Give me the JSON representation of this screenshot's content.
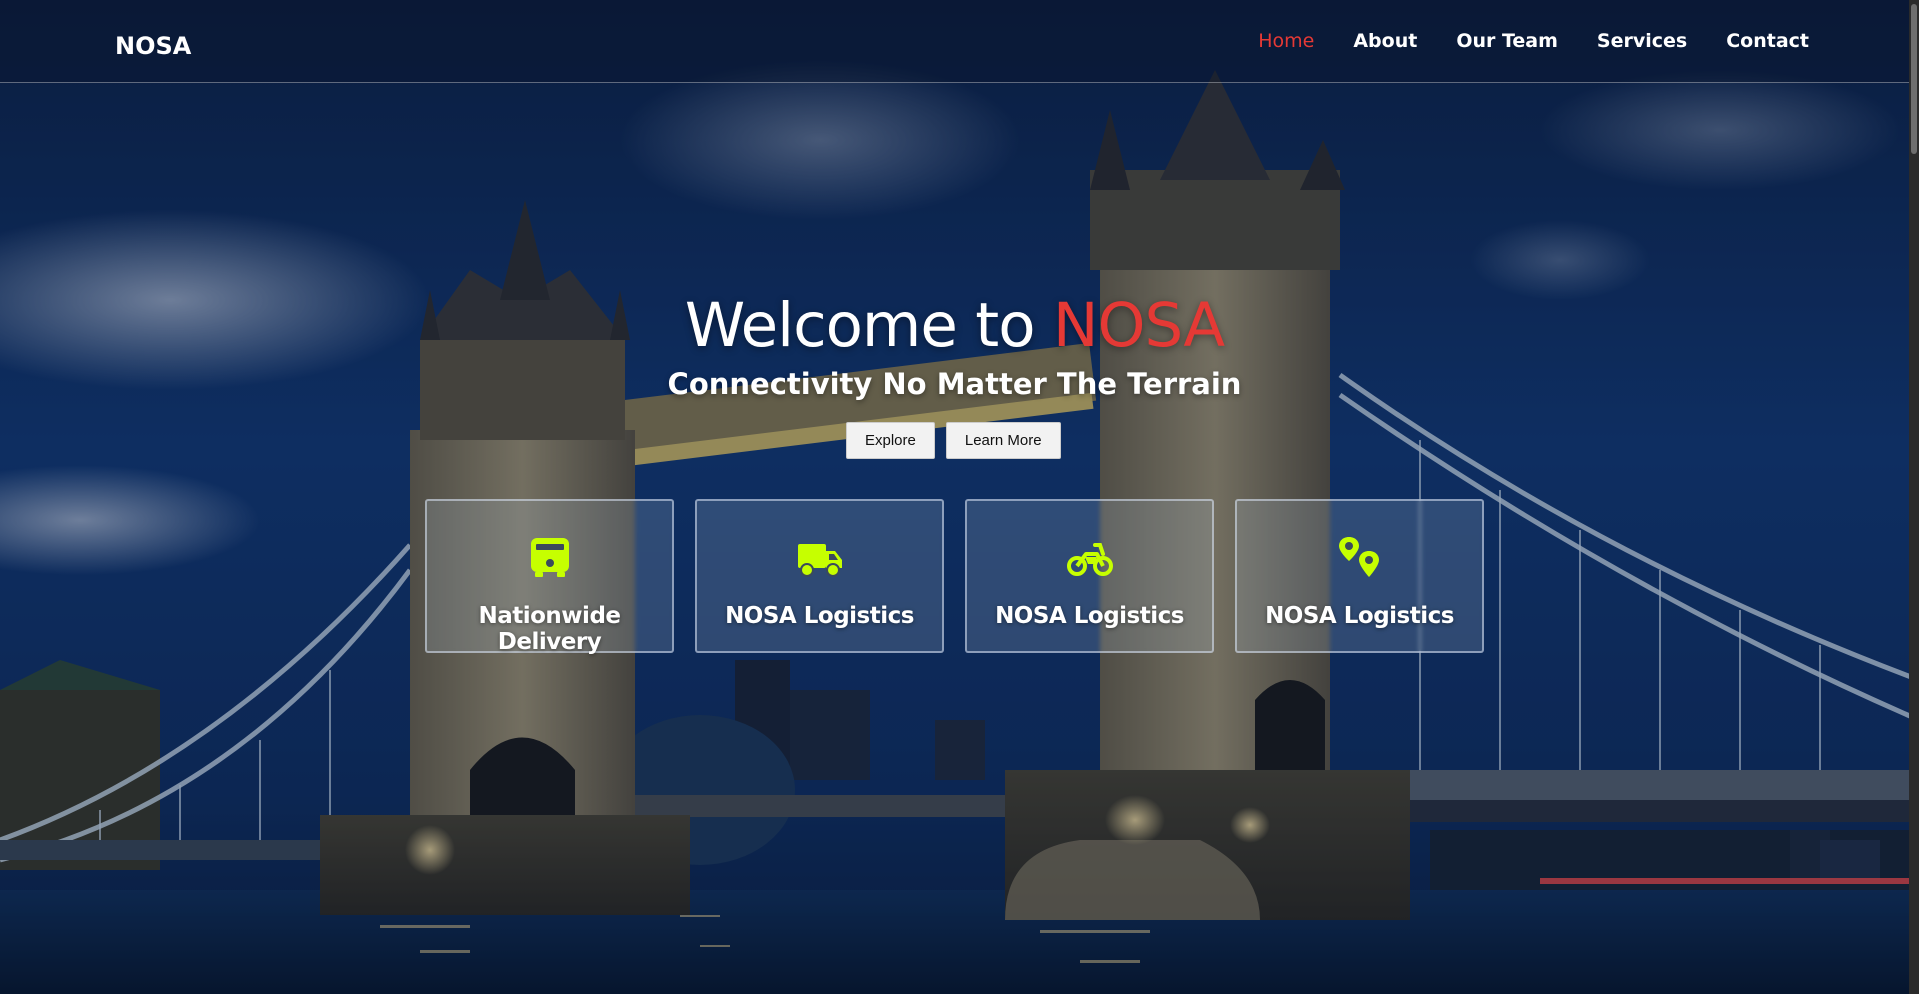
{
  "header": {
    "brand": "NOSA",
    "nav": [
      {
        "label": "Home",
        "active": true
      },
      {
        "label": "About",
        "active": false
      },
      {
        "label": "Our Team",
        "active": false
      },
      {
        "label": "Services",
        "active": false
      },
      {
        "label": "Contact",
        "active": false
      }
    ]
  },
  "hero": {
    "title_prefix": "Welcome to ",
    "title_accent": "NOSA",
    "subtitle": "Connectivity No Matter The Terrain",
    "buttons": {
      "explore": "Explore",
      "learn_more": "Learn More"
    }
  },
  "cards": [
    {
      "label": "Nationwide Delivery",
      "icon": "bus-icon"
    },
    {
      "label": "NOSA Logistics",
      "icon": "truck-icon"
    },
    {
      "label": "NOSA Logistics",
      "icon": "motorcycle-icon"
    },
    {
      "label": "NOSA Logistics",
      "icon": "map-pins-icon"
    }
  ],
  "colors": {
    "accent": "#e53935",
    "icon": "#c6ff00",
    "sky": "#0b2a5a"
  }
}
